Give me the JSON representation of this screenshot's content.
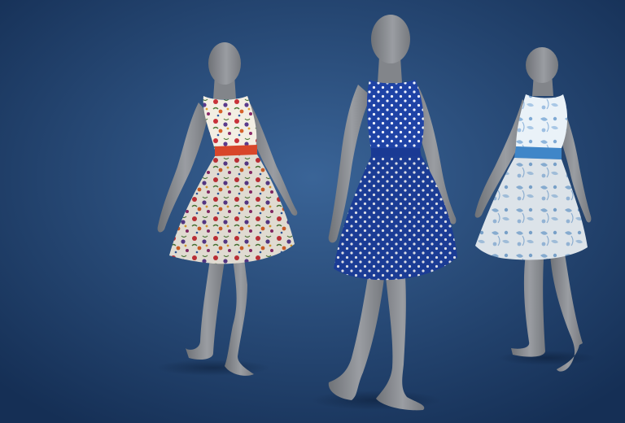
{
  "scene": {
    "background": {
      "center_color": "#3a6497",
      "edge_color": "#152f55"
    },
    "figures": [
      {
        "id": "left",
        "dress": "floral",
        "dress_base": "#f3eee3",
        "belt": "#d8462a",
        "skin": "#8a8d92"
      },
      {
        "id": "center",
        "dress": "polka-dot",
        "dress_base": "#1f43a6",
        "belt": "#1f43a6",
        "skin": "#8a8d92"
      },
      {
        "id": "right",
        "dress": "toile",
        "dress_base": "#eaf2f8",
        "belt": "#3f86c8",
        "skin": "#8a8d92"
      }
    ]
  }
}
